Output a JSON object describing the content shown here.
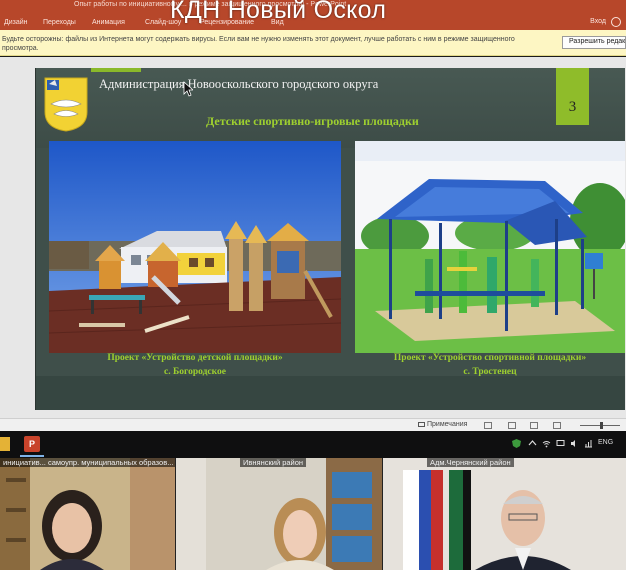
{
  "window": {
    "doc_title": "Опыт работы по инициативному ... в режиме защищенного просмотра]  -  PowerPoint",
    "overlay_title": "КДН Новый Оскол",
    "ribbon_tabs": [
      "Дизайн",
      "Переходы",
      "Анимация",
      "Слайд-шоу",
      "Рецензирование",
      "Вид"
    ],
    "signin": "Вход"
  },
  "protected_view": {
    "message": "Будьте осторожны: файлы из Интернета могут содержать вирусы. Если вам не нужно изменять этот документ, лучше работать с ним в режиме защищенного просмотра.",
    "button": "Разрешить редактирование"
  },
  "slide": {
    "header": "Администрация Новооскольского городского округа",
    "number": "3",
    "subtitle": "Детские спортивно-игровые площадки",
    "left": {
      "caption_line1": "Проект «Устройство детской площадки»",
      "caption_line2": "с. Богородское"
    },
    "right": {
      "caption_line1": "Проект «Устройство спортивной площадки»",
      "caption_line2": "с. Тростенец"
    }
  },
  "statusbar": {
    "notes_label": "Примечания"
  },
  "taskbar": {
    "lang": "ENG",
    "ppt_letter": "P"
  },
  "conference": {
    "tiles": [
      {
        "label": "инициатив... самоупр. муниципальных образов..."
      },
      {
        "label": "Ивнянский район"
      },
      {
        "label": "Адм.Чернянский район"
      }
    ]
  },
  "colors": {
    "ppt_red": "#b7472a",
    "slide_bg": "#3f4f4a",
    "accent_green": "#8fbc2a",
    "caption_green": "#9ed02f",
    "protected_bar": "#fdf6c3"
  }
}
